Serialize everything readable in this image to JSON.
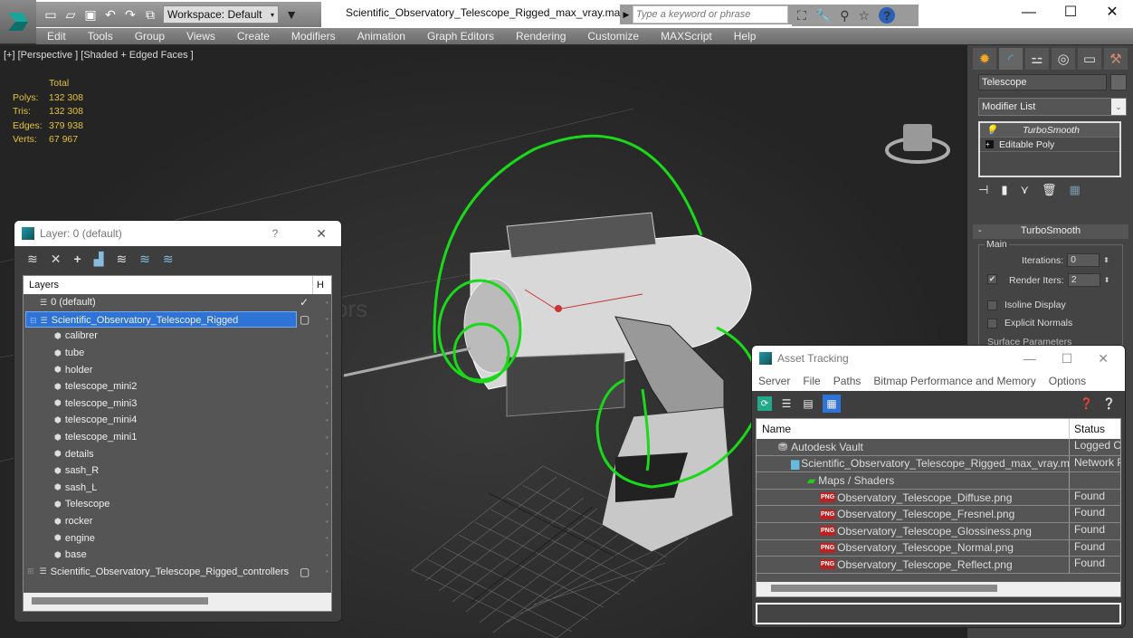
{
  "app": {
    "title": "Scientific_Observatory_Telescope_Rigged_max_vray.max",
    "workspace": "Workspace: Default",
    "search_placeholder": "Type a keyword or phrase",
    "menu": [
      "Edit",
      "Tools",
      "Group",
      "Views",
      "Create",
      "Modifiers",
      "Animation",
      "Graph Editors",
      "Rendering",
      "Customize",
      "MAXScript",
      "Help"
    ]
  },
  "viewport": {
    "label": "[+] [Perspective ] [Shaded + Edged Faces ]",
    "stats": {
      "header": "Total",
      "rows": [
        {
          "key": "Polys:",
          "value": "132 308"
        },
        {
          "key": "Tris:",
          "value": "132 308"
        },
        {
          "key": "Edges:",
          "value": "379 938"
        },
        {
          "key": "Verts:",
          "value": "67 967"
        }
      ]
    }
  },
  "command_panel": {
    "object_name": "Telescope",
    "modifier_list": "Modifier List",
    "stack": [
      "TurboSmooth",
      "Editable Poly"
    ],
    "rollout": "TurboSmooth",
    "group_main": "Main",
    "iterations_label": "Iterations:",
    "iterations_value": "0",
    "render_iters_label": "Render Iters:",
    "render_iters_value": "2",
    "render_iters_checked": true,
    "isoline_label": "Isoline Display",
    "isoline_checked": false,
    "explicit_normals_label": "Explicit Normals",
    "explicit_normals_checked": false,
    "surface_params": "Surface Parameters"
  },
  "layer_window": {
    "title": "Layer: 0 (default)",
    "help": "?",
    "columns": {
      "name": "Layers",
      "hide": "H"
    },
    "rows": [
      {
        "label": "0 (default)",
        "level": 1,
        "type": "layer",
        "checked": true
      },
      {
        "label": "Scientific_Observatory_Telescope_Rigged",
        "level": 0,
        "type": "layer",
        "selected": true,
        "box": true
      },
      {
        "label": "calibrer",
        "level": 2,
        "type": "object"
      },
      {
        "label": "tube",
        "level": 2,
        "type": "object"
      },
      {
        "label": "holder",
        "level": 2,
        "type": "object"
      },
      {
        "label": "telescope_mini2",
        "level": 2,
        "type": "object"
      },
      {
        "label": "telescope_mini3",
        "level": 2,
        "type": "object"
      },
      {
        "label": "telescope_mini4",
        "level": 2,
        "type": "object"
      },
      {
        "label": "telescope_mini1",
        "level": 2,
        "type": "object"
      },
      {
        "label": "details",
        "level": 2,
        "type": "object"
      },
      {
        "label": "sash_R",
        "level": 2,
        "type": "object"
      },
      {
        "label": "sash_L",
        "level": 2,
        "type": "object"
      },
      {
        "label": "Telescope",
        "level": 2,
        "type": "object"
      },
      {
        "label": "rocker",
        "level": 2,
        "type": "object"
      },
      {
        "label": "engine",
        "level": 2,
        "type": "object"
      },
      {
        "label": "base",
        "level": 2,
        "type": "object"
      },
      {
        "label": "Scientific_Observatory_Telescope_Rigged_controllers",
        "level": 0,
        "type": "layer",
        "box": true
      }
    ]
  },
  "asset_window": {
    "title": "Asset Tracking",
    "menu": [
      "Server",
      "File",
      "Paths",
      "Bitmap Performance and Memory",
      "Options"
    ],
    "columns": {
      "name": "Name",
      "status": "Status"
    },
    "rows": [
      {
        "name": "Autodesk Vault",
        "status": "Logged Out",
        "indent": 1,
        "icon": "vault"
      },
      {
        "name": "Scientific_Observatory_Telescope_Rigged_max_vray.max",
        "status": "Network Path",
        "indent": 2,
        "icon": "max"
      },
      {
        "name": "Maps / Shaders",
        "status": "",
        "indent": 3,
        "icon": "maps"
      },
      {
        "name": "Observatory_Telescope_Diffuse.png",
        "status": "Found",
        "indent": 4,
        "icon": "png"
      },
      {
        "name": "Observatory_Telescope_Fresnel.png",
        "status": "Found",
        "indent": 4,
        "icon": "png"
      },
      {
        "name": "Observatory_Telescope_Glossiness.png",
        "status": "Found",
        "indent": 4,
        "icon": "png"
      },
      {
        "name": "Observatory_Telescope_Normal.png",
        "status": "Found",
        "indent": 4,
        "icon": "png"
      },
      {
        "name": "Observatory_Telescope_Reflect.png",
        "status": "Found",
        "indent": 4,
        "icon": "png"
      }
    ]
  }
}
